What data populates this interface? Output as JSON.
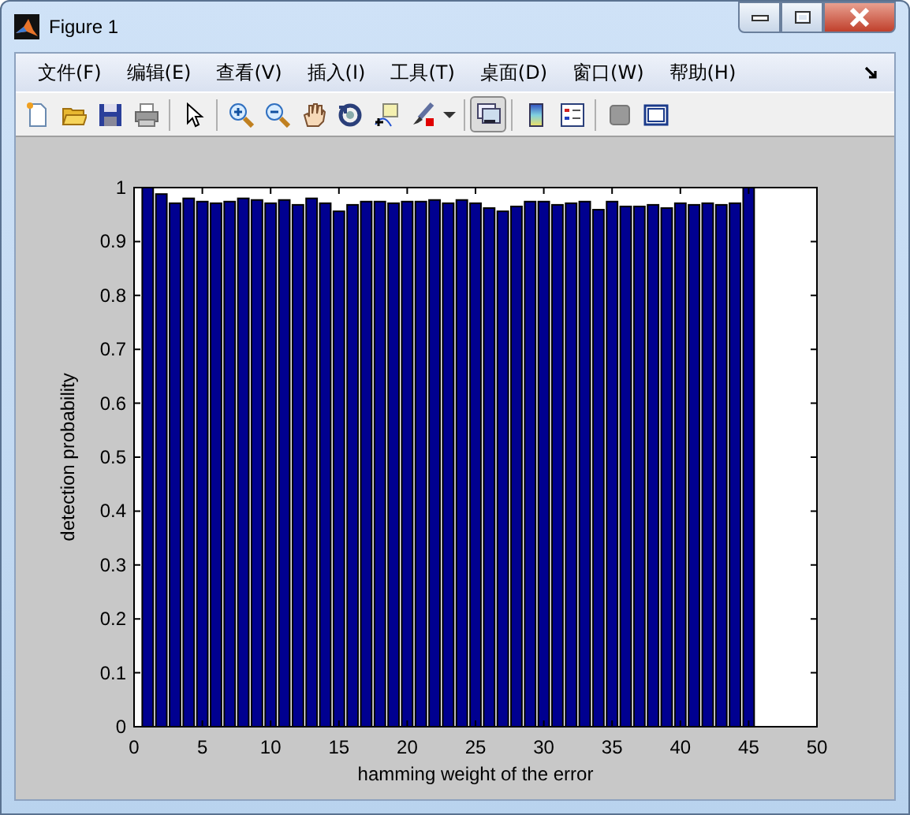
{
  "window": {
    "title": "Figure 1"
  },
  "menu": [
    "文件(F)",
    "编辑(E)",
    "查看(V)",
    "插入(I)",
    "工具(T)",
    "桌面(D)",
    "窗口(W)",
    "帮助(H)"
  ],
  "toolbar_buttons": [
    {
      "selected": false
    },
    {
      "selected": false
    },
    {
      "selected": false
    },
    {
      "selected": false
    },
    {
      "selected": false
    },
    {
      "selected": false
    },
    {
      "selected": false
    },
    {
      "selected": false
    },
    {
      "selected": false
    },
    {
      "selected": false
    },
    {
      "selected": false
    },
    {
      "selected": false
    },
    {
      "selected": true
    },
    {
      "selected": false
    },
    {
      "selected": false
    },
    {
      "selected": false
    },
    {
      "selected": false
    }
  ],
  "figure": {
    "chart_data": {
      "type": "bar",
      "xlabel": "hamming weight of the error",
      "ylabel": "detection probability",
      "x": [
        1,
        2,
        3,
        4,
        5,
        6,
        7,
        8,
        9,
        10,
        11,
        12,
        13,
        14,
        15,
        16,
        17,
        18,
        19,
        20,
        21,
        22,
        23,
        24,
        25,
        26,
        27,
        28,
        29,
        30,
        31,
        32,
        33,
        34,
        35,
        36,
        37,
        38,
        39,
        40,
        41,
        42,
        43,
        44,
        45
      ],
      "values": [
        1,
        0.988,
        0.971,
        0.98,
        0.974,
        0.971,
        0.974,
        0.98,
        0.977,
        0.971,
        0.977,
        0.968,
        0.98,
        0.971,
        0.956,
        0.968,
        0.974,
        0.974,
        0.971,
        0.974,
        0.974,
        0.977,
        0.971,
        0.977,
        0.971,
        0.962,
        0.956,
        0.965,
        0.974,
        0.974,
        0.968,
        0.971,
        0.974,
        0.959,
        0.974,
        0.965,
        0.965,
        0.968,
        0.962,
        0.971,
        0.968,
        0.971,
        0.968,
        0.971,
        1
      ],
      "xlim": [
        0,
        50
      ],
      "ylim": [
        0,
        1
      ],
      "xticks": [
        0,
        5,
        10,
        15,
        20,
        25,
        30,
        35,
        40,
        45,
        50
      ],
      "yticks": [
        0,
        0.1,
        0.2,
        0.3,
        0.4,
        0.5,
        0.6,
        0.7,
        0.8,
        0.9,
        1
      ]
    }
  }
}
